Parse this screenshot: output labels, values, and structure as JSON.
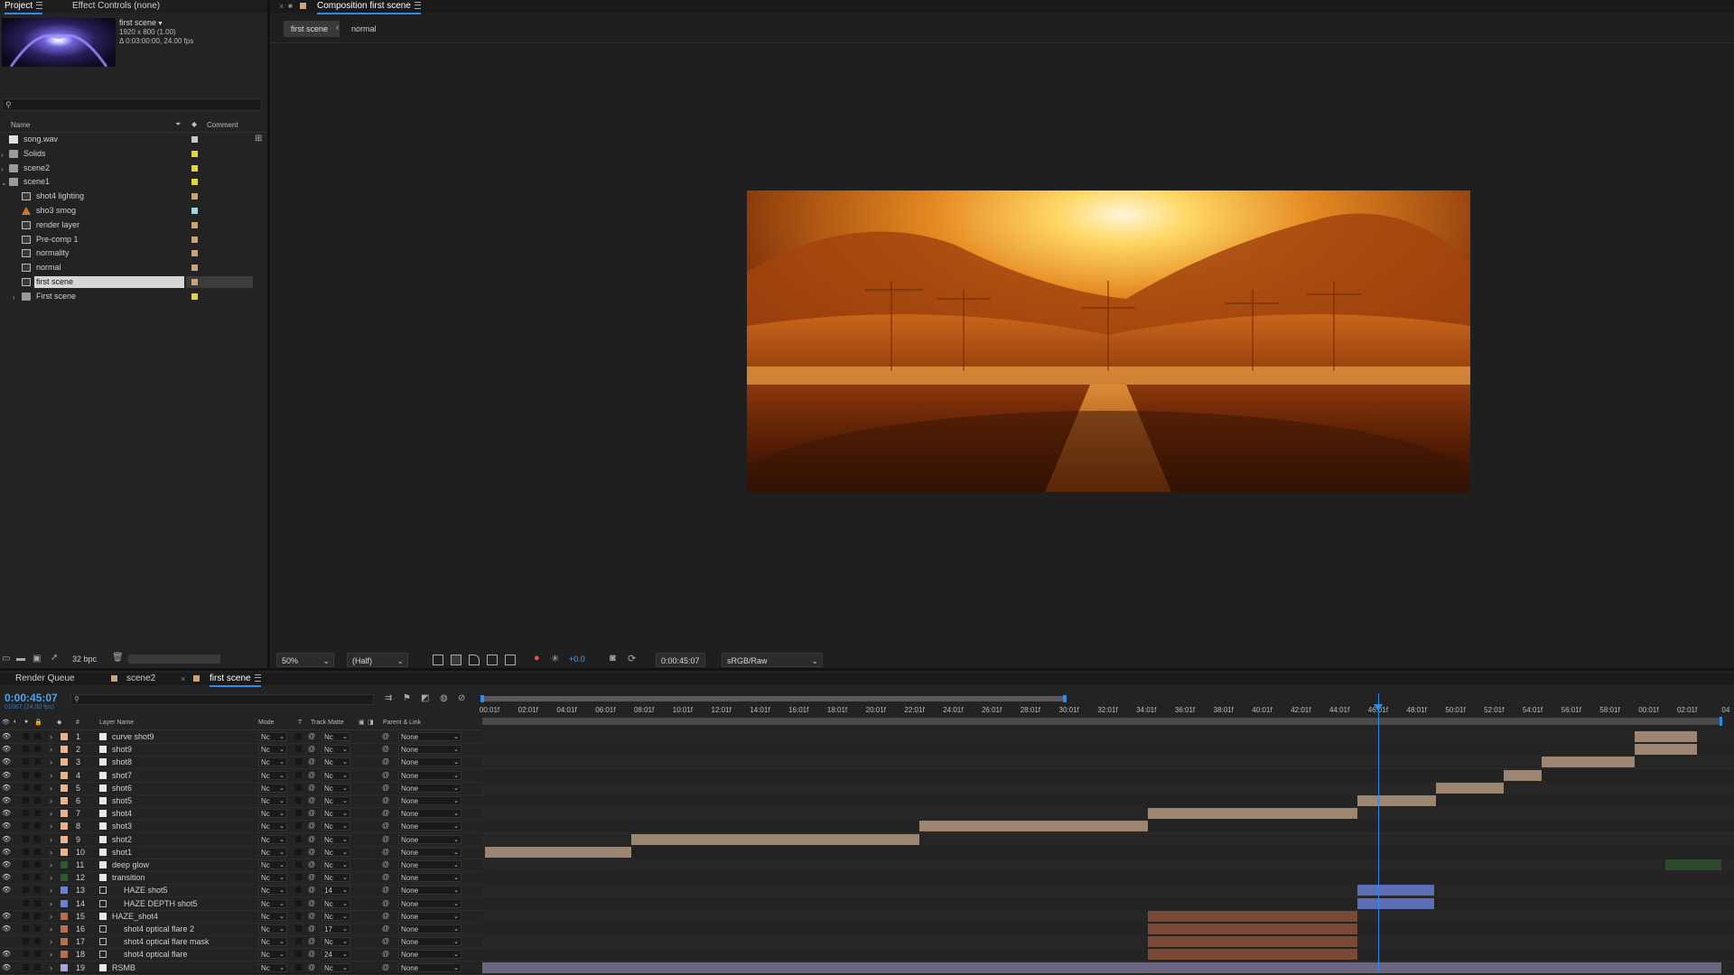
{
  "project_panel": {
    "tabs": [
      {
        "label": "Project",
        "active": true
      },
      {
        "label": "Effect Controls (none)",
        "active": false
      }
    ],
    "selected_item": {
      "name": "first scene",
      "dimensions": "1920 x 800 (1.00)",
      "info": "Δ 0:03:00:00, 24.00 fps"
    },
    "columns": {
      "name": "Name",
      "comment": "Comment"
    },
    "items": [
      {
        "name": "song.wav",
        "type": "audio",
        "color": "#c8c8c8",
        "indent": 0,
        "twirl": ""
      },
      {
        "name": "Solids",
        "type": "folder",
        "color": "#e2d34a",
        "indent": 0,
        "twirl": "›"
      },
      {
        "name": "scene2",
        "type": "folder",
        "color": "#e2d34a",
        "indent": 0,
        "twirl": "›"
      },
      {
        "name": "scene1",
        "type": "folder",
        "color": "#e2d34a",
        "indent": 0,
        "twirl": "⌄"
      },
      {
        "name": "shot4 lighting",
        "type": "comp",
        "color": "#c9a27e",
        "indent": 1,
        "twirl": ""
      },
      {
        "name": "sho3 smog",
        "type": "ai",
        "color": "#a8d4e0",
        "indent": 1,
        "twirl": ""
      },
      {
        "name": "render layer",
        "type": "comp",
        "color": "#c9a27e",
        "indent": 1,
        "twirl": ""
      },
      {
        "name": "Pre-comp 1",
        "type": "comp",
        "color": "#c9a27e",
        "indent": 1,
        "twirl": ""
      },
      {
        "name": "normality",
        "type": "comp",
        "color": "#c9a27e",
        "indent": 1,
        "twirl": ""
      },
      {
        "name": "normal",
        "type": "comp",
        "color": "#c9a27e",
        "indent": 1,
        "twirl": ""
      },
      {
        "name": "first scene",
        "type": "comp",
        "color": "#c9a27e",
        "indent": 1,
        "twirl": "",
        "selected": true
      },
      {
        "name": "First scene",
        "type": "folder",
        "color": "#e2d34a",
        "indent": 1,
        "twirl": "›"
      }
    ],
    "footer": {
      "bpc": "32 bpc"
    }
  },
  "composition_panel": {
    "title": "Composition first scene",
    "breadcrumb_active": "first scene",
    "breadcrumb_next": "normal",
    "toolbar": {
      "zoom": "50%",
      "resolution": "(Half)",
      "exposure": "+0.0",
      "timecode": "0:00:45:07",
      "color_space": "sRGB/Raw"
    }
  },
  "timeline": {
    "tabs": [
      {
        "label": "Render Queue"
      },
      {
        "label": "scene2"
      },
      {
        "label": "first scene",
        "active": true
      }
    ],
    "current_time": "0:00:45:07",
    "frame_info": "01087 (24.00 fps)",
    "columns": {
      "num": "#",
      "layer_name": "Layer Name",
      "mode": "Mode",
      "t": "T",
      "track_matte": "Track Matte",
      "parent": "Parent & Link"
    },
    "ruler": [
      "00:01f",
      "02:01f",
      "04:01f",
      "06:01f",
      "08:01f",
      "10:01f",
      "12:01f",
      "14:01f",
      "16:01f",
      "18:01f",
      "20:01f",
      "22:01f",
      "24:01f",
      "26:01f",
      "28:01f",
      "30:01f",
      "32:01f",
      "34:01f",
      "36:01f",
      "38:01f",
      "40:01f",
      "42:01f",
      "44:01f",
      "46:01f",
      "48:01f",
      "50:01f",
      "52:01f",
      "54:01f",
      "56:01f",
      "58:01f",
      "00:01f",
      "02:01f",
      "04"
    ],
    "playhead_ruler_fraction": 0.5,
    "layers": [
      {
        "num": "1",
        "name": "curve shot9",
        "label": "#e8b48e",
        "icon": "solid",
        "mode": "Nc",
        "tm": "Nc",
        "parent": "None",
        "eye": true,
        "bar": {
          "start": 0.93,
          "end": 0.98,
          "color": "#9c8672"
        }
      },
      {
        "num": "2",
        "name": "shot9",
        "label": "#e8b48e",
        "icon": "solid",
        "mode": "Nc",
        "tm": "Nc",
        "parent": "None",
        "eye": true,
        "bar": {
          "start": 0.93,
          "end": 0.98,
          "color": "#9c8672"
        }
      },
      {
        "num": "3",
        "name": "shot8",
        "label": "#e8b48e",
        "icon": "solid",
        "mode": "Nc",
        "tm": "Nc",
        "parent": "None",
        "eye": true,
        "bar": {
          "start": 0.855,
          "end": 0.93,
          "color": "#9c8672"
        }
      },
      {
        "num": "4",
        "name": "shot7",
        "label": "#e8b48e",
        "icon": "solid",
        "mode": "Nc",
        "tm": "Nc",
        "parent": "None",
        "eye": true,
        "bar": {
          "start": 0.824,
          "end": 0.855,
          "color": "#9c8672"
        }
      },
      {
        "num": "5",
        "name": "shot6",
        "label": "#e8b48e",
        "icon": "solid",
        "mode": "Nc",
        "tm": "Nc",
        "parent": "None",
        "eye": true,
        "bar": {
          "start": 0.77,
          "end": 0.824,
          "color": "#9c8672"
        }
      },
      {
        "num": "6",
        "name": "shot5",
        "label": "#e8b48e",
        "icon": "solid",
        "mode": "Nc",
        "tm": "Nc",
        "parent": "None",
        "eye": true,
        "bar": {
          "start": 0.706,
          "end": 0.77,
          "color": "#9c8672"
        }
      },
      {
        "num": "7",
        "name": "shot4",
        "label": "#e8b48e",
        "icon": "solid",
        "mode": "Nc",
        "tm": "Nc",
        "parent": "None",
        "eye": true,
        "bar": {
          "start": 0.537,
          "end": 0.706,
          "color": "#9c8672"
        }
      },
      {
        "num": "8",
        "name": "shot3",
        "label": "#e8b48e",
        "icon": "solid",
        "mode": "Nc",
        "tm": "Nc",
        "parent": "None",
        "eye": true,
        "bar": {
          "start": 0.353,
          "end": 0.537,
          "color": "#9c8672"
        }
      },
      {
        "num": "9",
        "name": "shot2",
        "label": "#e8b48e",
        "icon": "solid",
        "mode": "Nc",
        "tm": "Nc",
        "parent": "None",
        "eye": true,
        "bar": {
          "start": 0.12,
          "end": 0.353,
          "color": "#9c8672"
        }
      },
      {
        "num": "10",
        "name": "shot1",
        "label": "#e8b48e",
        "icon": "solid",
        "mode": "Nc",
        "tm": "Nc",
        "parent": "None",
        "eye": true,
        "bar": {
          "start": 0.002,
          "end": 0.12,
          "color": "#9c8672"
        }
      },
      {
        "num": "11",
        "name": "deep glow",
        "label": "#2e5a2e",
        "icon": "solid",
        "mode": "Nc",
        "tm": "Nc",
        "parent": "None",
        "eye": true,
        "bar": {
          "start": 0.955,
          "end": 1.0,
          "color": "#2c4a2c"
        }
      },
      {
        "num": "12",
        "name": "transition",
        "label": "#2e5a2e",
        "icon": "solid",
        "mode": "Nc",
        "tm": "Nc",
        "parent": "None",
        "eye": true,
        "bar": null
      },
      {
        "num": "13",
        "name": "HAZE shot5",
        "label": "#6d7fd9",
        "icon": "comp",
        "mode": "Nc",
        "tm": "14",
        "parent": "None",
        "eye": true,
        "bar": {
          "start": 0.706,
          "end": 0.768,
          "color": "#5d6eb8"
        }
      },
      {
        "num": "14",
        "name": "HAZE DEPTH shot5",
        "label": "#6d7fd9",
        "icon": "comp",
        "mode": "Nc",
        "tm": "Nc",
        "parent": "None",
        "eye": false,
        "bar": {
          "start": 0.706,
          "end": 0.768,
          "color": "#5d6eb8"
        }
      },
      {
        "num": "15",
        "name": "HAZE_shot4",
        "label": "#b86e52",
        "icon": "solid",
        "mode": "Nc",
        "tm": "Nc",
        "parent": "None",
        "eye": true,
        "bar": {
          "start": 0.537,
          "end": 0.706,
          "color": "#7a4a38"
        }
      },
      {
        "num": "16",
        "name": "shot4 optical flare 2",
        "label": "#b86e52",
        "icon": "comp",
        "mode": "Nc",
        "tm": "17",
        "parent": "None",
        "eye": true,
        "bar": {
          "start": 0.537,
          "end": 0.706,
          "color": "#7a4a38"
        }
      },
      {
        "num": "17",
        "name": "shot4 optical flare mask",
        "label": "#b86e52",
        "icon": "comp",
        "mode": "Nc",
        "tm": "Nc",
        "parent": "None",
        "eye": false,
        "bar": {
          "start": 0.537,
          "end": 0.706,
          "color": "#7a4a38"
        }
      },
      {
        "num": "18",
        "name": "shot4 optical flare",
        "label": "#b86e52",
        "icon": "comp",
        "mode": "Nc",
        "tm": "24",
        "parent": "None",
        "eye": true,
        "bar": {
          "start": 0.537,
          "end": 0.706,
          "color": "#7a4a38"
        }
      },
      {
        "num": "19",
        "name": "RSMB",
        "label": "#a9a2d8",
        "icon": "solid",
        "mode": "Nc",
        "tm": "Nc",
        "parent": "None",
        "eye": true,
        "bar": {
          "start": 0.0,
          "end": 1.0,
          "color": "#6b6782"
        }
      }
    ]
  }
}
